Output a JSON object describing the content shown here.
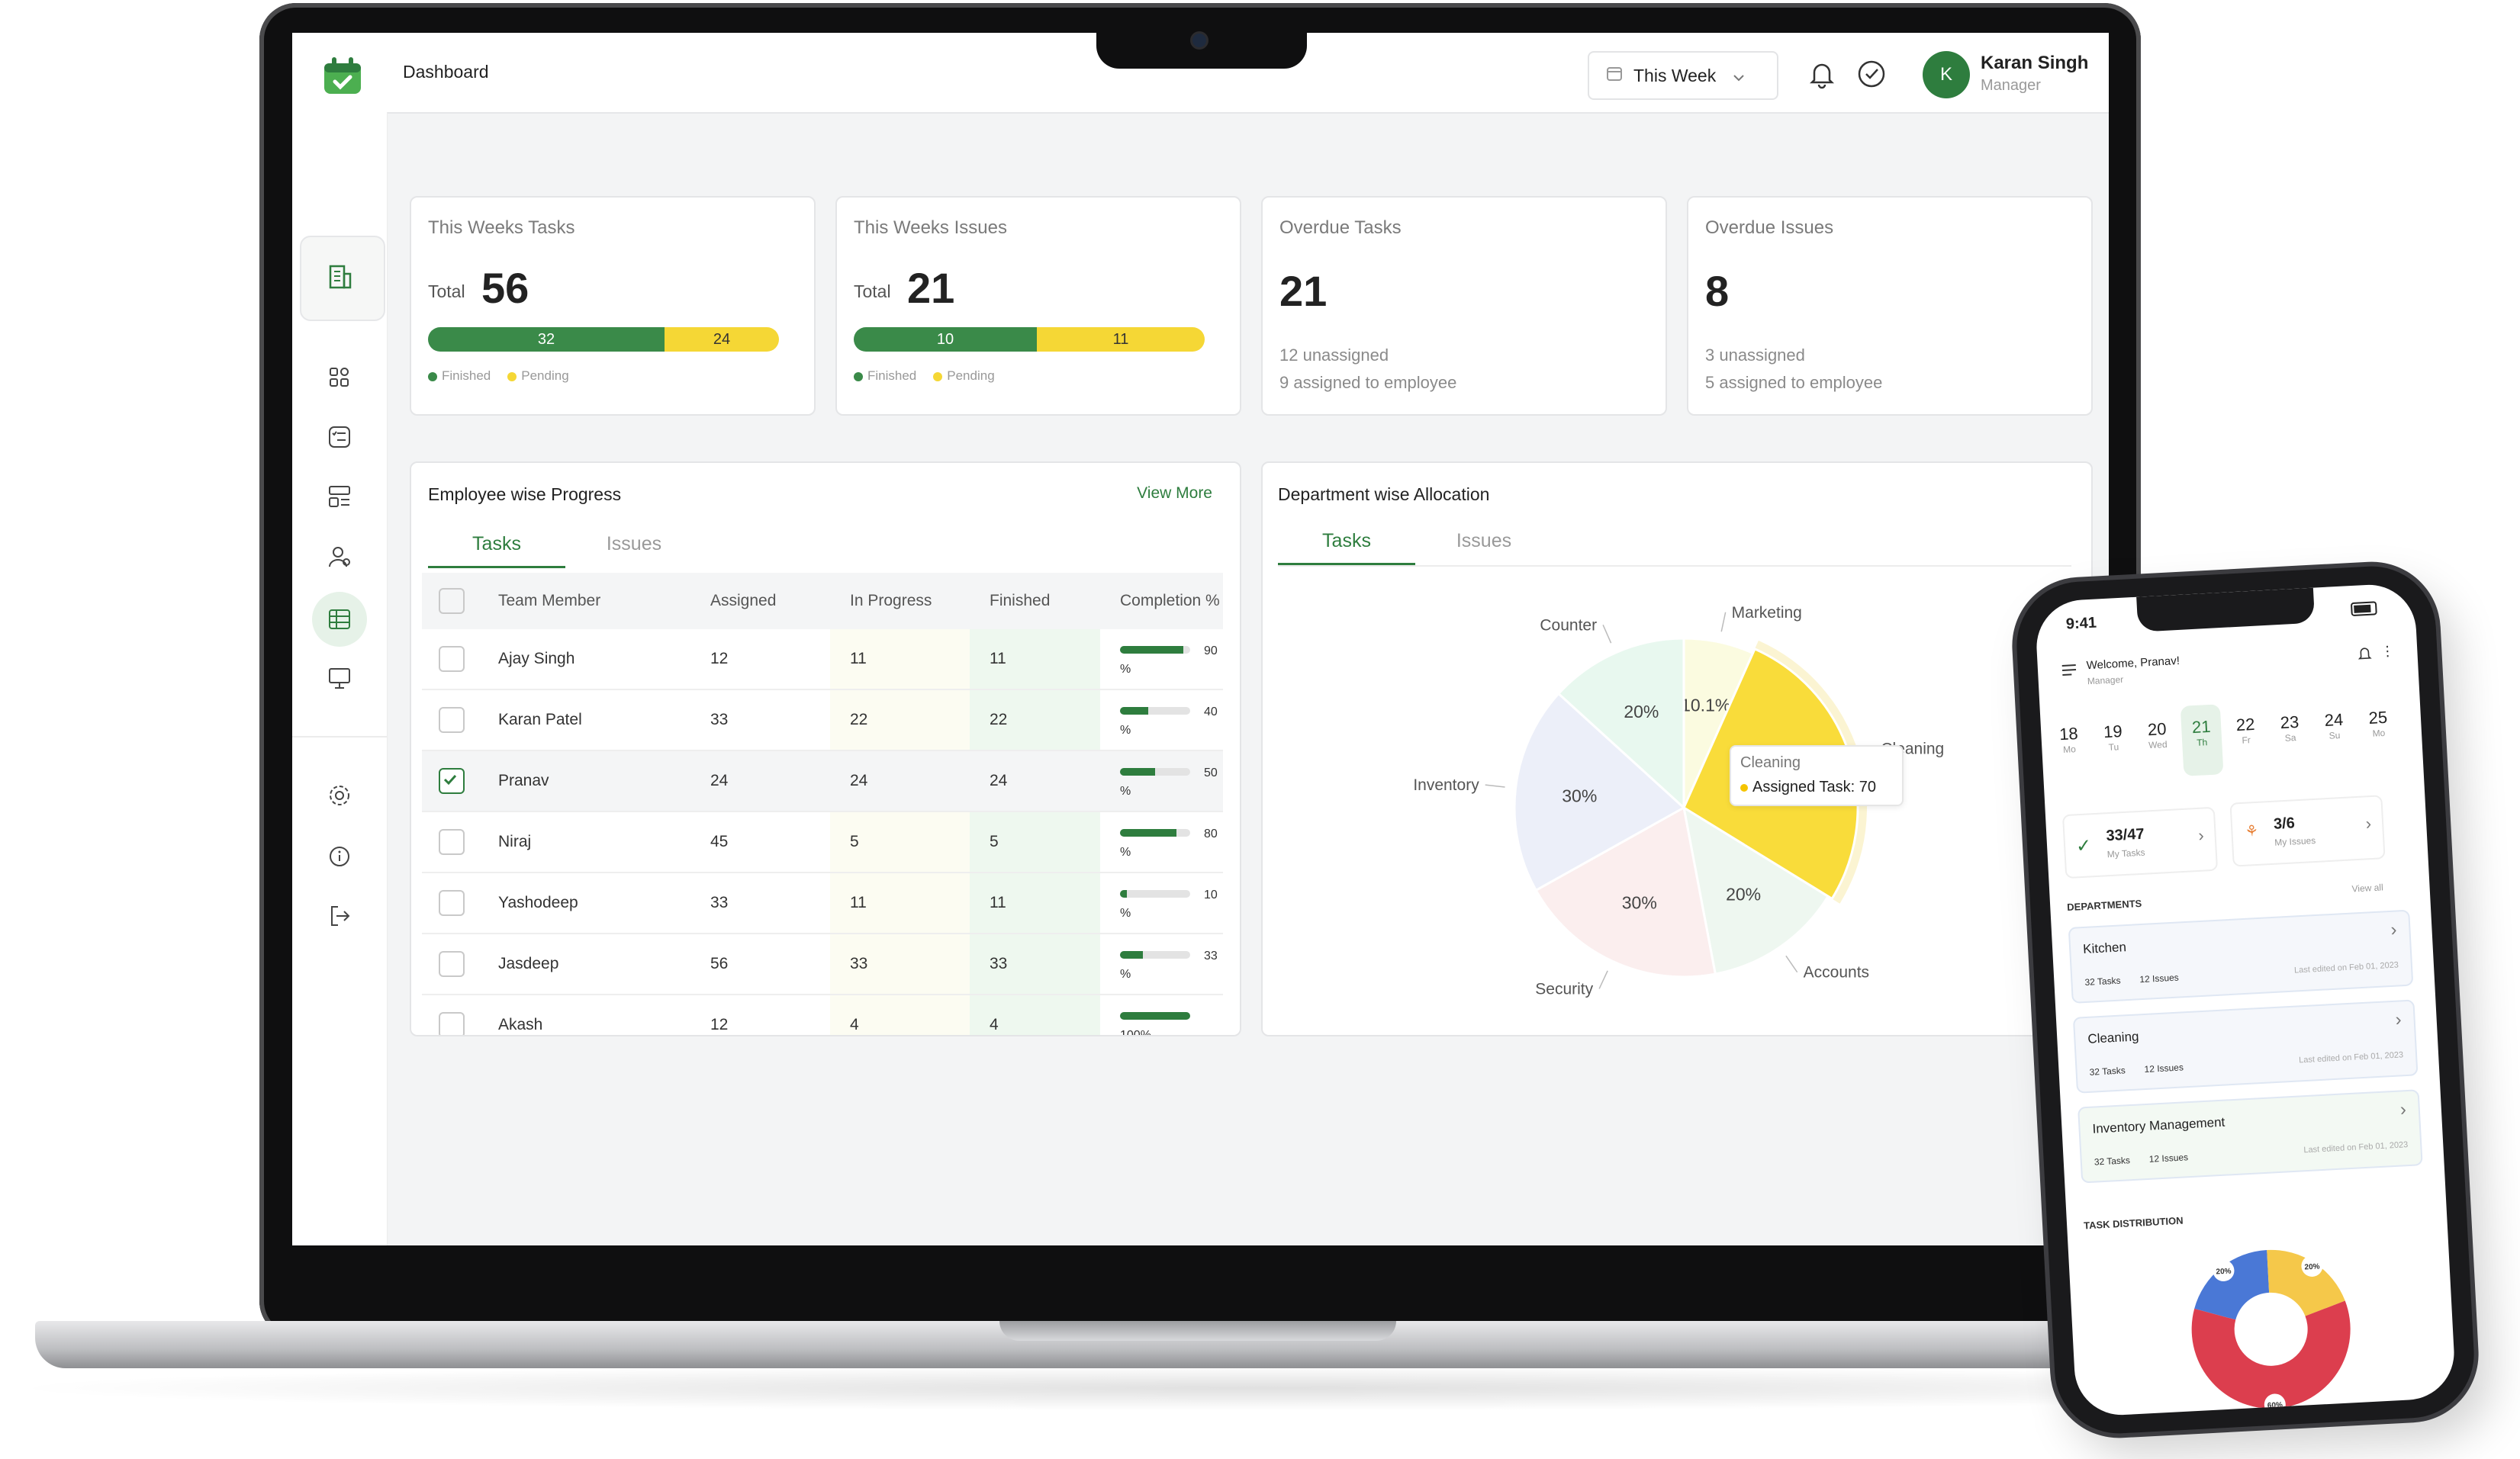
{
  "header": {
    "page_title": "Dashboard",
    "period_select": "This Week",
    "user_initial": "K",
    "user_name": "Karan Singh",
    "user_role": "Manager"
  },
  "colors": {
    "brand_green": "#2e7d3e",
    "pending_yellow": "#f5d735",
    "finished_green": "#3a8a49"
  },
  "stats": {
    "weekly_tasks": {
      "title": "This Weeks Tasks",
      "total_label": "Total",
      "total": "56",
      "finished": "32",
      "pending": "24",
      "finished_label": "Finished",
      "pending_label": "Pending"
    },
    "weekly_issues": {
      "title": "This Weeks Issues",
      "total_label": "Total",
      "total": "21",
      "finished": "10",
      "pending": "11",
      "finished_label": "Finished",
      "pending_label": "Pending"
    },
    "overdue_tasks": {
      "title": "Overdue Tasks",
      "value": "21",
      "line1": "12 unassigned",
      "line2": "9 assigned to employee"
    },
    "overdue_issues": {
      "title": "Overdue Issues",
      "value": "8",
      "line1": "3 unassigned",
      "line2": "5 assigned to employee"
    }
  },
  "employee_progress": {
    "title": "Employee wise Progress",
    "view_more": "View More",
    "tabs": [
      "Tasks",
      "Issues"
    ],
    "columns": [
      "Team Member",
      "Assigned",
      "In Progress",
      "Finished",
      "Completion %"
    ],
    "rows": [
      {
        "name": "Ajay Singh",
        "assigned": "12",
        "in_progress": "11",
        "finished": "11",
        "completion": "90 %",
        "fraction": 0.9,
        "checked": false
      },
      {
        "name": "Karan Patel",
        "assigned": "33",
        "in_progress": "22",
        "finished": "22",
        "completion": "40 %",
        "fraction": 0.4,
        "checked": false
      },
      {
        "name": "Pranav",
        "assigned": "24",
        "in_progress": "24",
        "finished": "24",
        "completion": "50 %",
        "fraction": 0.5,
        "checked": true
      },
      {
        "name": "Niraj",
        "assigned": "45",
        "in_progress": "5",
        "finished": "5",
        "completion": "80 %",
        "fraction": 0.8,
        "checked": false
      },
      {
        "name": "Yashodeep",
        "assigned": "33",
        "in_progress": "11",
        "finished": "11",
        "completion": "10 %",
        "fraction": 0.1,
        "checked": false
      },
      {
        "name": "Jasdeep",
        "assigned": "56",
        "in_progress": "33",
        "finished": "33",
        "completion": "33 %",
        "fraction": 0.33,
        "checked": false
      },
      {
        "name": "Akash",
        "assigned": "12",
        "in_progress": "4",
        "finished": "4",
        "completion": "100%",
        "fraction": 1.0,
        "checked": false
      }
    ]
  },
  "department_allocation": {
    "title": "Department wise Allocation",
    "tabs": [
      "Tasks",
      "Issues"
    ],
    "tooltip_title": "Cleaning",
    "tooltip_value": "Assigned Task: 70"
  },
  "chart_data": [
    {
      "type": "pie",
      "categories": [
        "Cleaning",
        "Accounts",
        "Security",
        "Inventory",
        "Counter",
        "Marketing"
      ],
      "values": [
        40.9,
        20,
        30,
        30,
        20,
        10.1
      ],
      "value_labels": [
        "40.9%",
        "20%",
        "30%",
        "30%",
        "20%",
        "10.1%"
      ],
      "colors": [
        "#f9dc3a",
        "#eef7f0",
        "#fbeeee",
        "#eceff9",
        "#e8f8ef",
        "#fbfbe0"
      ],
      "title": "Department wise Allocation"
    },
    {
      "type": "pie",
      "categories": [
        "Blue",
        "Yellow",
        "Red"
      ],
      "values": [
        20,
        20,
        60
      ],
      "value_labels": [
        "20%",
        "20%",
        "60%"
      ],
      "colors": [
        "#4a78d6",
        "#f5c84a",
        "#dc3e4e"
      ],
      "title": "TASK DISTRIBUTION"
    }
  ],
  "phone": {
    "time": "9:41",
    "welcome": "Welcome, Pranav!",
    "role": "Manager",
    "dates": [
      {
        "day": "18",
        "wd": "Mo"
      },
      {
        "day": "19",
        "wd": "Tu"
      },
      {
        "day": "20",
        "wd": "Wed"
      },
      {
        "day": "21",
        "wd": "Th"
      },
      {
        "day": "22",
        "wd": "Fr"
      },
      {
        "day": "23",
        "wd": "Sa"
      },
      {
        "day": "24",
        "wd": "Su"
      },
      {
        "day": "25",
        "wd": "Mo"
      }
    ],
    "my_tasks_value": "33/47",
    "my_tasks_label": "My Tasks",
    "my_issues_value": "3/6",
    "my_issues_label": "My Issues",
    "departments_heading": "DEPARTMENTS",
    "view_all": "View all",
    "departments": [
      {
        "name": "Kitchen",
        "tasks": "32 Tasks",
        "issues": "12 Issues",
        "edited": "Last edited on Feb 01, 2023"
      },
      {
        "name": "Cleaning",
        "tasks": "32 Tasks",
        "issues": "12 Issues",
        "edited": "Last edited on Feb 01, 2023"
      },
      {
        "name": "Inventory Management",
        "tasks": "32 Tasks",
        "issues": "12 Issues",
        "edited": "Last edited on Feb 01, 2023"
      }
    ],
    "distribution_heading": "TASK DISTRIBUTION"
  }
}
